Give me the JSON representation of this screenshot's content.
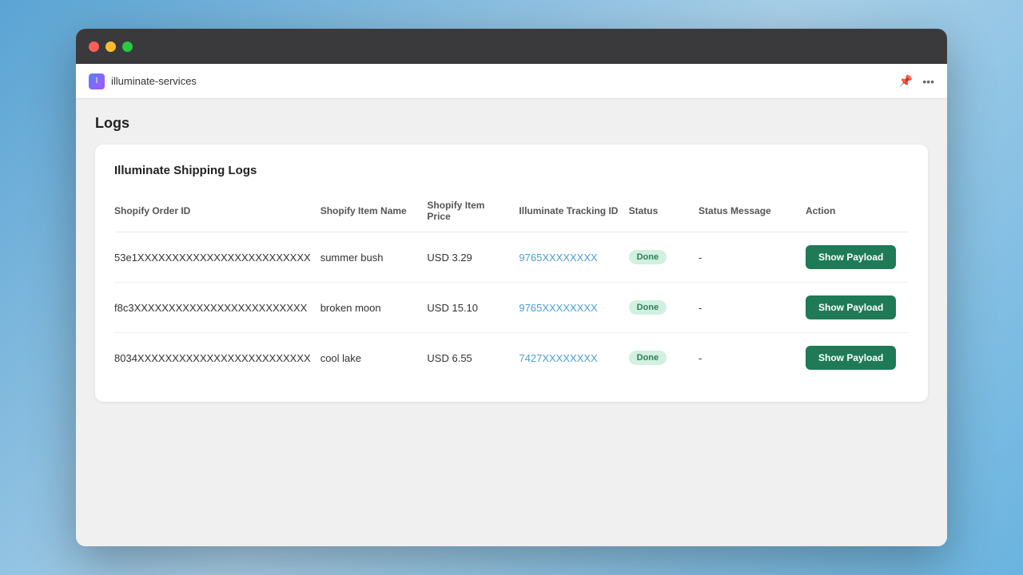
{
  "window": {
    "app_icon_label": "I",
    "app_name": "illuminate-services",
    "pin_icon": "📌",
    "more_icon": "···"
  },
  "page": {
    "title": "Logs"
  },
  "table": {
    "card_title": "Illuminate Shipping Logs",
    "columns": [
      "Shopify Order ID",
      "Shopify Item Name",
      "Shopify Item Price",
      "Illuminate Tracking ID",
      "Status",
      "Status Message",
      "Action"
    ],
    "rows": [
      {
        "order_id": "53e1XXXXXXXXXXXXXXXXXXXXXXXXX",
        "item_name": "summer bush",
        "item_price": "USD 3.29",
        "tracking_id": "9765XXXXXXXX",
        "status": "Done",
        "status_message": "-",
        "action_label": "Show Payload"
      },
      {
        "order_id": "f8c3XXXXXXXXXXXXXXXXXXXXXXXXX",
        "item_name": "broken moon",
        "item_price": "USD 15.10",
        "tracking_id": "9765XXXXXXXX",
        "status": "Done",
        "status_message": "-",
        "action_label": "Show Payload"
      },
      {
        "order_id": "8034XXXXXXXXXXXXXXXXXXXXXXXXX",
        "item_name": "cool lake",
        "item_price": "USD 6.55",
        "tracking_id": "7427XXXXXXXX",
        "status": "Done",
        "status_message": "-",
        "action_label": "Show Payload"
      }
    ]
  }
}
